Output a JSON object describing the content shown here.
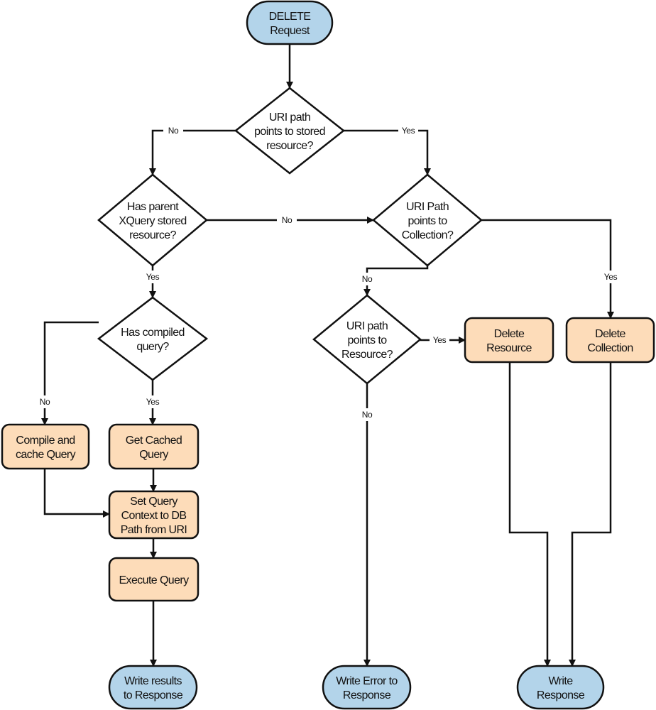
{
  "colors": {
    "terminal": "#b3d4ea",
    "process": "#fddcb9",
    "decision": "#ffffff",
    "stroke": "#111111"
  },
  "nodes": {
    "start": {
      "kind": "terminal",
      "lines": [
        "DELETE",
        "Request"
      ]
    },
    "d_stored": {
      "kind": "decision",
      "lines": [
        "URI path",
        "points to stored",
        "resource?"
      ]
    },
    "d_parent": {
      "kind": "decision",
      "lines": [
        "Has parent",
        "XQuery stored",
        "resource?"
      ]
    },
    "d_collection": {
      "kind": "decision",
      "lines": [
        "URI Path",
        "points to",
        "Collection?"
      ]
    },
    "d_compiled": {
      "kind": "decision",
      "lines": [
        "Has compiled",
        "query?"
      ]
    },
    "d_resource": {
      "kind": "decision",
      "lines": [
        "URI path",
        "points to",
        "Resource?"
      ]
    },
    "compile": {
      "kind": "process",
      "lines": [
        "Compile and",
        "cache Query"
      ]
    },
    "cached": {
      "kind": "process",
      "lines": [
        "Get Cached",
        "Query"
      ]
    },
    "context": {
      "kind": "process",
      "lines": [
        "Set Query",
        "Context to DB",
        "Path from URI"
      ]
    },
    "execute": {
      "kind": "process",
      "lines": [
        "Execute Query"
      ]
    },
    "del_resource": {
      "kind": "process",
      "lines": [
        "Delete",
        "Resource"
      ]
    },
    "del_collection": {
      "kind": "process",
      "lines": [
        "Delete",
        "Collection"
      ]
    },
    "write_results": {
      "kind": "terminal",
      "lines": [
        "Write results",
        "to Response"
      ]
    },
    "write_error": {
      "kind": "terminal",
      "lines": [
        "Write Error to",
        "Response"
      ]
    },
    "write_response": {
      "kind": "terminal",
      "lines": [
        "Write",
        "Response"
      ]
    }
  },
  "edges": [
    {
      "from": "start",
      "to": "d_stored",
      "label": ""
    },
    {
      "from": "d_stored",
      "to": "d_parent",
      "label": "No"
    },
    {
      "from": "d_stored",
      "to": "d_collection",
      "label": "Yes"
    },
    {
      "from": "d_parent",
      "to": "d_collection",
      "label": "No"
    },
    {
      "from": "d_parent",
      "to": "d_compiled",
      "label": "Yes"
    },
    {
      "from": "d_collection",
      "to": "del_collection",
      "label": "Yes"
    },
    {
      "from": "d_collection",
      "to": "d_resource",
      "label": "No"
    },
    {
      "from": "d_compiled",
      "to": "compile",
      "label": "No"
    },
    {
      "from": "d_compiled",
      "to": "cached",
      "label": "Yes"
    },
    {
      "from": "d_resource",
      "to": "del_resource",
      "label": "Yes"
    },
    {
      "from": "d_resource",
      "to": "write_error",
      "label": "No"
    },
    {
      "from": "compile",
      "to": "context",
      "label": ""
    },
    {
      "from": "cached",
      "to": "context",
      "label": ""
    },
    {
      "from": "context",
      "to": "execute",
      "label": ""
    },
    {
      "from": "execute",
      "to": "write_results",
      "label": ""
    },
    {
      "from": "del_resource",
      "to": "write_response",
      "label": ""
    },
    {
      "from": "del_collection",
      "to": "write_response",
      "label": ""
    }
  ]
}
